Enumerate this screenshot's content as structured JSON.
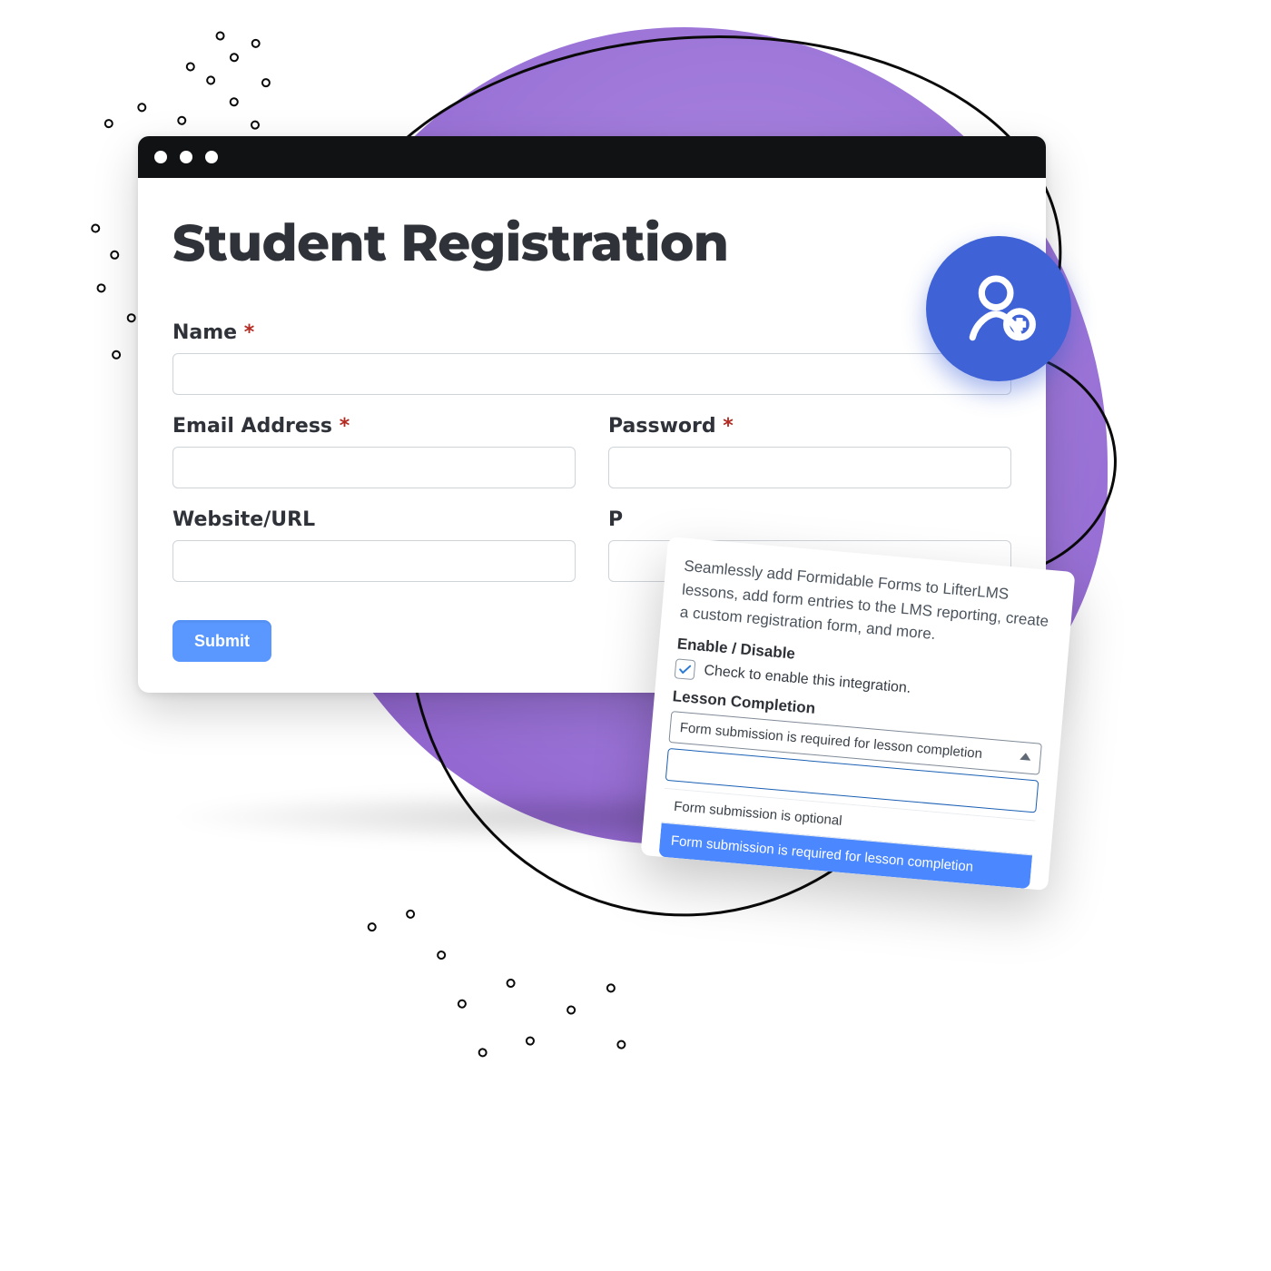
{
  "title": "Student Registration",
  "fields": {
    "name": {
      "label": "Name",
      "required": true,
      "value": ""
    },
    "email": {
      "label": "Email Address",
      "required": true,
      "value": ""
    },
    "password": {
      "label": "Password",
      "required": true,
      "value": ""
    },
    "website": {
      "label": "Website/URL",
      "required": false,
      "value": ""
    },
    "phone": {
      "label": "P",
      "required": false,
      "value": ""
    }
  },
  "required_marker": "*",
  "submit_label": "Submit",
  "panel": {
    "lead": "Seamlessly add Formidable Forms to LifterLMS lessons, add form entries to the LMS reporting, create a custom registration form, and more.",
    "enable_label": "Enable / Disable",
    "enable_checkbox_label": "Check to enable this integration.",
    "enable_checked": true,
    "section_label": "Lesson Completion",
    "select_value": "Form submission is required for lesson completion",
    "options": [
      {
        "text": "Form submission is optional",
        "selected": false
      },
      {
        "text": "Form submission is required for lesson completion",
        "selected": true
      }
    ]
  },
  "badge": {
    "icon": "user-plus-icon"
  }
}
